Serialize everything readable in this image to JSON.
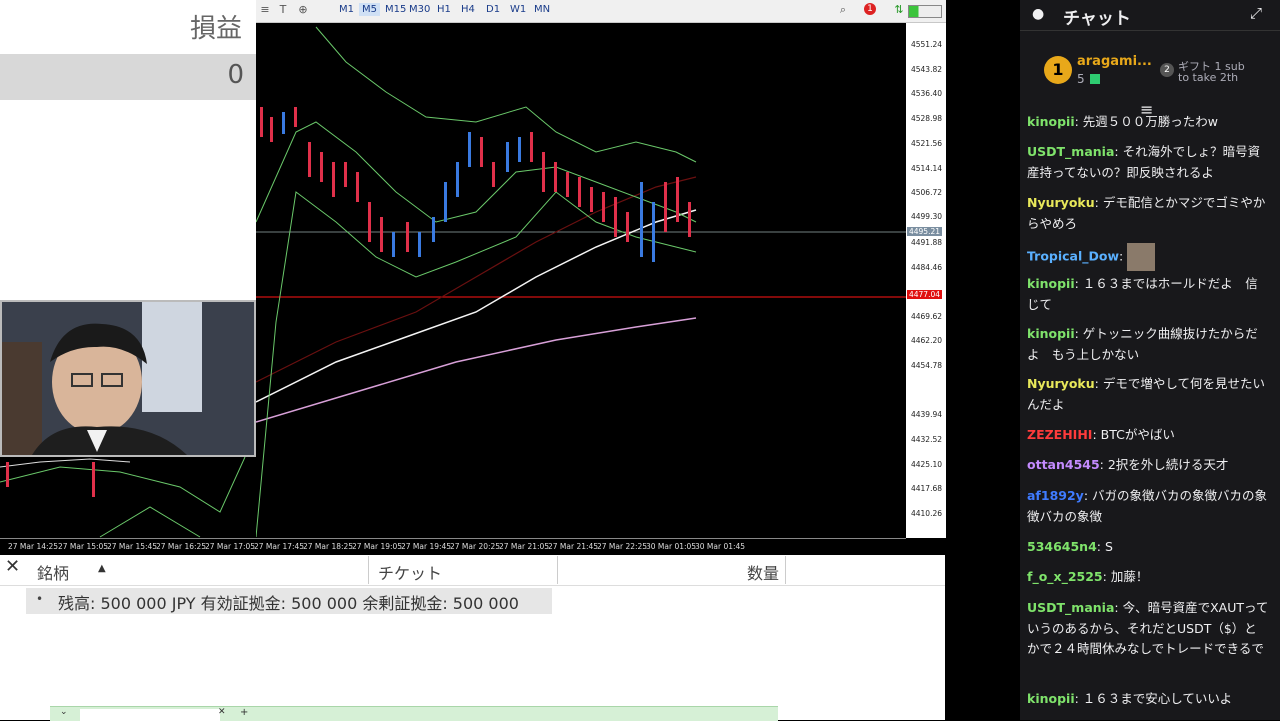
{
  "pnl": {
    "title": "損益",
    "value": "0"
  },
  "toolbar": {
    "timeframes": [
      "M1",
      "M5",
      "M15",
      "M30",
      "H1",
      "H4",
      "D1",
      "W1",
      "MN"
    ],
    "selected": "M5",
    "notif_count": "1"
  },
  "price_axis": [
    "4551.24",
    "4543.82",
    "4536.40",
    "4528.98",
    "4521.56",
    "4514.14",
    "4506.72",
    "4499.30",
    "4491.88",
    "4484.46",
    "4477.04",
    "4469.62",
    "4462.20",
    "4454.78",
    "4439.94",
    "4432.52",
    "4425.10",
    "4417.68",
    "4410.26"
  ],
  "current_price": "4495.21",
  "red_line_price": "4477.04",
  "time_axis": [
    "27 Mar 14:25",
    "27 Mar 15:05",
    "27 Mar 15:45",
    "27 Mar 16:25",
    "27 Mar 17:05",
    "27 Mar 17:45",
    "27 Mar 18:25",
    "27 Mar 19:05",
    "27 Mar 19:45",
    "27 Mar 20:25",
    "27 Mar 21:05",
    "27 Mar 21:45",
    "27 Mar 22:25",
    "30 Mar 01:05",
    "30 Mar 01:45"
  ],
  "terminal": {
    "columns": [
      "銘柄",
      "チケット",
      "数量"
    ],
    "balance": "残高: 500 000 JPY  有効証拠金: 500 000  余剰証拠金: 500 000"
  },
  "chat": {
    "title": "チャット",
    "top_gifter": {
      "rank": "1",
      "name": "aragami...",
      "count": "5",
      "gift_label": "ギフト 1 sub",
      "gift_sub": "to take 2th"
    },
    "messages": [
      {
        "user": "kinopii",
        "color": "#7fe36b",
        "text": "先週５００万勝ったわw"
      },
      {
        "user": "USDT_mania",
        "color": "#7fe36b",
        "text": "それ海外でしょ？暗号資産持ってないの？即反映されるよ"
      },
      {
        "user": "Nyuryoku",
        "color": "#e8e85a",
        "text": "デモ配信とかマジでゴミやからやめろ"
      },
      {
        "user": "Tropical_Dow",
        "color": "#5ab0ff",
        "text": ""
      },
      {
        "user": "kinopii",
        "color": "#7fe36b",
        "text": "１６３まではホールドだよ　信じて"
      },
      {
        "user": "kinopii",
        "color": "#7fe36b",
        "text": "ゲトッニック曲線抜けたからだよ　もう上しかない"
      },
      {
        "user": "Nyuryoku",
        "color": "#e8e85a",
        "text": "デモで増やして何を見せたいんだよ"
      },
      {
        "user": "ZEZEHIHI",
        "color": "#ff3b3b",
        "text": "BTCがやばい"
      },
      {
        "user": "ottan4545",
        "color": "#c48bff",
        "text": "2択を外し続ける天才"
      },
      {
        "user": "af1892y",
        "color": "#3f7bff",
        "text": "バガの象徴バカの象徴バカの象徴バカの象徴"
      },
      {
        "user": "534645n4",
        "color": "#7fe36b",
        "text": "S"
      },
      {
        "user": "f_o_x_2525",
        "color": "#7fe36b",
        "text": "加藤！"
      },
      {
        "user": "USDT_mania",
        "color": "#7fe36b",
        "text": "今、暗号資産でXAUTっていうのあるから、それだとUSDT（$）とかで２４時間休みなしでトレードできるで"
      },
      {
        "user": "kinopii",
        "color": "#7fe36b",
        "text": "１６３まで安心していいよ"
      }
    ]
  }
}
